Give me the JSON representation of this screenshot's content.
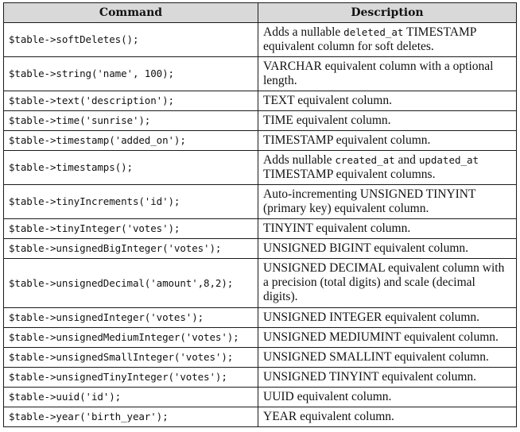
{
  "table": {
    "headers": {
      "command": "Command",
      "description": "Description"
    },
    "rows": [
      {
        "command": "$table->softDeletes();",
        "desc": [
          {
            "t": "Adds a nullable "
          },
          {
            "c": "deleted_at"
          },
          {
            "t": " TIMESTAMP equivalent column for soft deletes."
          }
        ]
      },
      {
        "command": "$table->string('name', 100);",
        "desc": [
          {
            "t": "VARCHAR equivalent column with a optional length."
          }
        ]
      },
      {
        "command": "$table->text('description');",
        "desc": [
          {
            "t": "TEXT equivalent column."
          }
        ]
      },
      {
        "command": "$table->time('sunrise');",
        "desc": [
          {
            "t": "TIME equivalent column."
          }
        ]
      },
      {
        "command": "$table->timestamp('added_on');",
        "desc": [
          {
            "t": "TIMESTAMP equivalent column."
          }
        ]
      },
      {
        "command": "$table->timestamps();",
        "desc": [
          {
            "t": "Adds nullable "
          },
          {
            "c": "created_at"
          },
          {
            "t": " and "
          },
          {
            "c": "updated_at"
          },
          {
            "t": " TIMESTAMP equivalent columns."
          }
        ]
      },
      {
        "command": "$table->tinyIncrements('id');",
        "desc": [
          {
            "t": "Auto-incrementing UNSIGNED TINYINT (primary key) equivalent column."
          }
        ]
      },
      {
        "command": "$table->tinyInteger('votes');",
        "desc": [
          {
            "t": "TINYINT equivalent column."
          }
        ]
      },
      {
        "command": "$table->unsignedBigInteger('votes');",
        "desc": [
          {
            "t": "UNSIGNED BIGINT equivalent column."
          }
        ]
      },
      {
        "command": "$table->unsignedDecimal('amount',8,2);",
        "desc": [
          {
            "t": "UNSIGNED DECIMAL equivalent column with a precision (total digits) and scale (decimal digits)."
          }
        ]
      },
      {
        "command": "$table->unsignedInteger('votes');",
        "desc": [
          {
            "t": "UNSIGNED INTEGER equivalent column."
          }
        ]
      },
      {
        "command": "$table->unsignedMediumInteger('votes');",
        "desc": [
          {
            "t": "UNSIGNED MEDIUMINT equivalent column."
          }
        ]
      },
      {
        "command": "$table->unsignedSmallInteger('votes');",
        "desc": [
          {
            "t": "UNSIGNED SMALLINT equivalent column."
          }
        ]
      },
      {
        "command": "$table->unsignedTinyInteger('votes');",
        "desc": [
          {
            "t": "UNSIGNED TINYINT equivalent column."
          }
        ]
      },
      {
        "command": "$table->uuid('id');",
        "desc": [
          {
            "t": "UUID equivalent column."
          }
        ]
      },
      {
        "command": "$table->year('birth_year');",
        "desc": [
          {
            "t": "YEAR equivalent column."
          }
        ]
      }
    ]
  }
}
